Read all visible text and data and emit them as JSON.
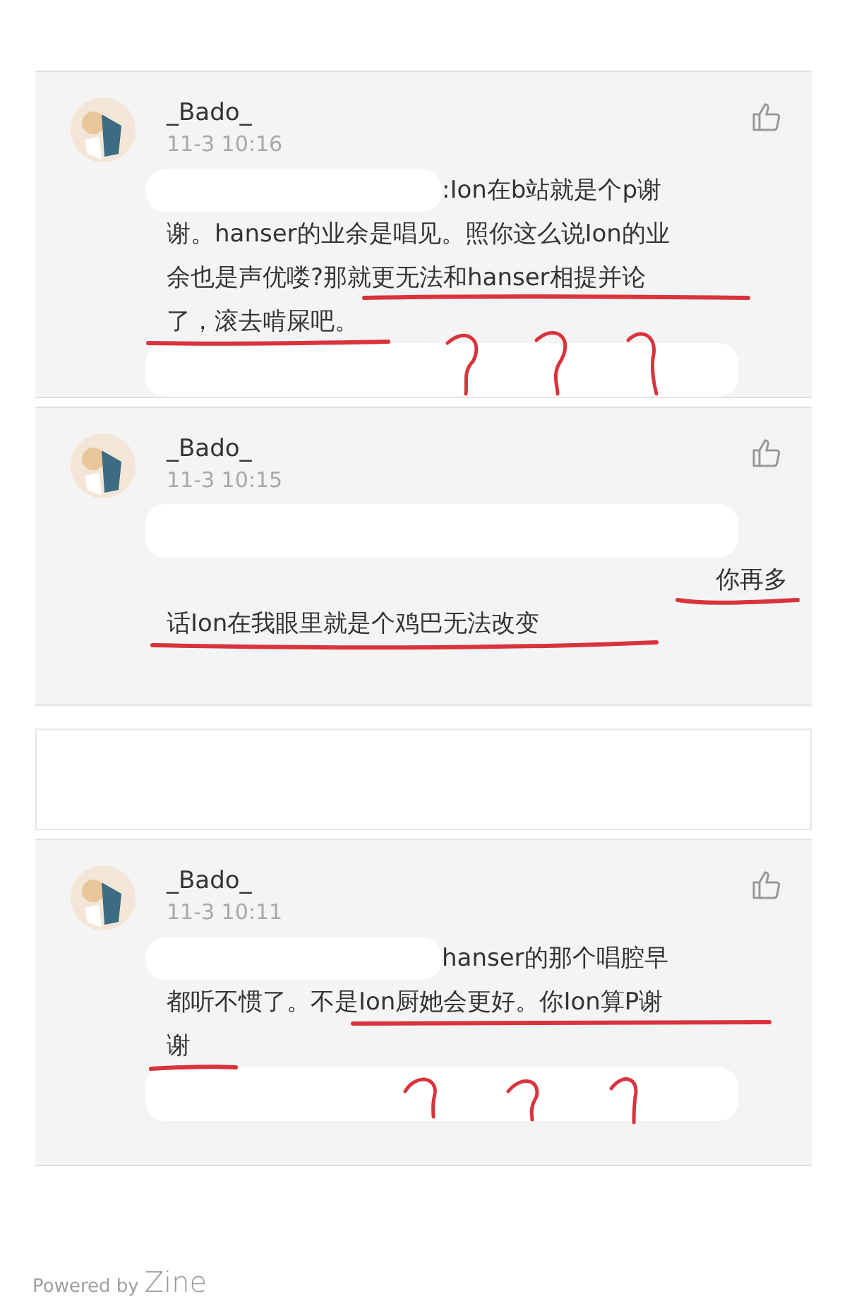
{
  "cards": [
    {
      "kind": "comment",
      "user": "_Bado_",
      "time": "11-3 10:16",
      "body": [
        {
          "kind": "redacted-text",
          "text": ":Ion在b站就是个p谢"
        },
        {
          "kind": "text",
          "text": "谢。hanser的业余是唱见。照你这么说Ion的业"
        },
        {
          "kind": "text",
          "text": "余也是声优喽?那就更无法和hanser相提并论"
        },
        {
          "kind": "text",
          "text": "了，滚去啃屎吧。"
        },
        {
          "kind": "redaction"
        }
      ]
    },
    {
      "kind": "comment",
      "user": "_Bado_",
      "time": "11-3 10:15",
      "body": [
        {
          "kind": "redaction"
        },
        {
          "kind": "text-end",
          "text": "你再多"
        },
        {
          "kind": "text",
          "text": "话Ion在我眼里就是个鸡巴无法改变"
        }
      ]
    },
    {
      "kind": "empty"
    },
    {
      "kind": "comment",
      "user": "_Bado_",
      "time": "11-3 10:11",
      "body": [
        {
          "kind": "redacted-text",
          "text": "hanser的那个唱腔早"
        },
        {
          "kind": "text",
          "text": "都听不惯了。不是Ion厨她会更好。你Ion算P谢"
        },
        {
          "kind": "text",
          "text": "谢"
        },
        {
          "kind": "redaction"
        }
      ]
    }
  ],
  "footer": {
    "prefix": "Powered by",
    "brand": "Zine"
  }
}
